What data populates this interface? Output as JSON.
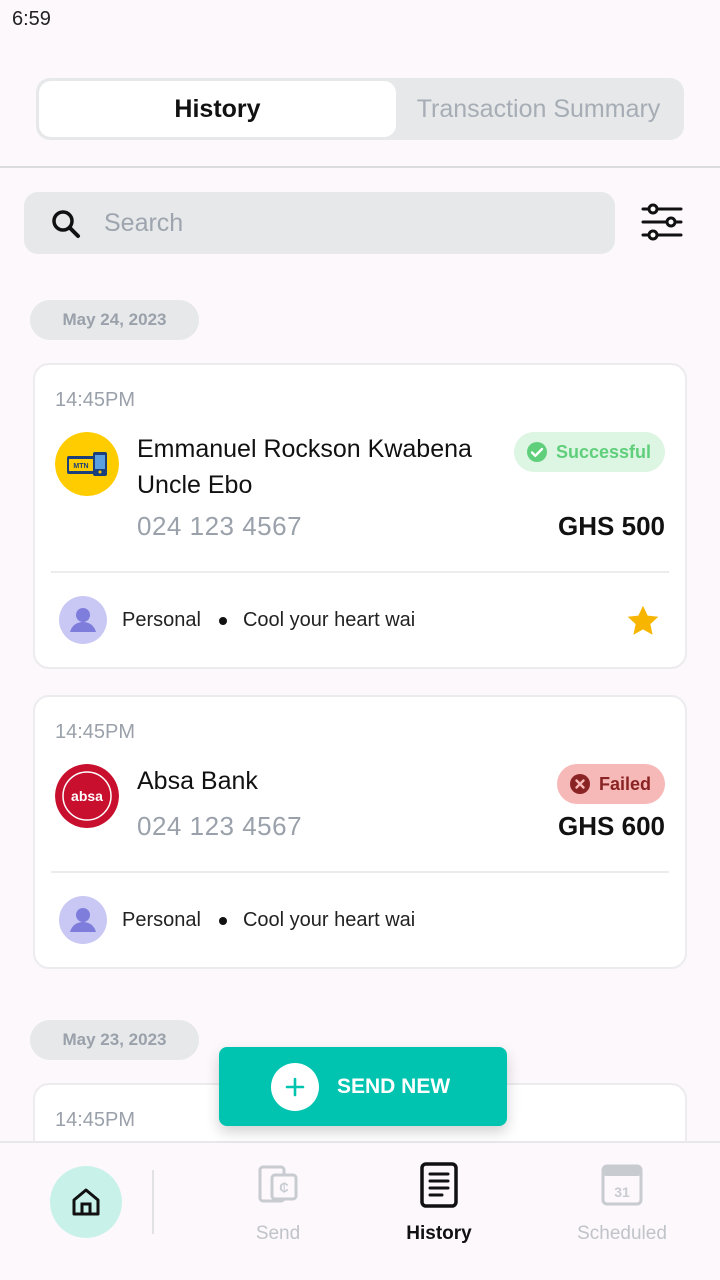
{
  "status_bar": {
    "time": "6:59"
  },
  "tabs": {
    "history": "History",
    "summary": "Transaction Summary"
  },
  "search": {
    "placeholder": "Search"
  },
  "groups": [
    {
      "date": "May 24, 2023"
    },
    {
      "date": "May 23, 2023"
    }
  ],
  "transactions": [
    {
      "time": "14:45PM",
      "name": "Emmanuel Rockson Kwabena Uncle Ebo",
      "phone": "024 123 4567",
      "status": "Successful",
      "amount": "GHS 500",
      "category": "Personal",
      "note": "Cool your heart wai",
      "starred": true,
      "provider_icon": "mtn-momo-logo"
    },
    {
      "time": "14:45PM",
      "name": "Absa Bank",
      "phone": "024 123 4567",
      "status": "Failed",
      "amount": "GHS 600",
      "category": "Personal",
      "note": "Cool your heart wai",
      "starred": false,
      "provider_icon": "absa-logo"
    },
    {
      "time": "14:45PM"
    }
  ],
  "fab": {
    "label": "SEND NEW"
  },
  "nav": {
    "send": "Send",
    "history": "History",
    "scheduled": "Scheduled"
  },
  "colors": {
    "accent": "#00c4b0",
    "success_text": "#5fcf7c",
    "success_bg": "#ddf5e3",
    "failed_text": "#8a2323",
    "failed_bg": "#f7b8b8",
    "star": "#f7b500"
  }
}
